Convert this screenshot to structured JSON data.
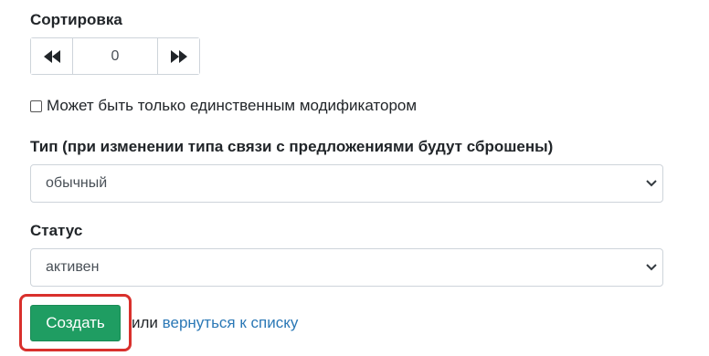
{
  "sort": {
    "label": "Сортировка",
    "value": "0"
  },
  "single_modifier": {
    "label": "Может быть только единственным модификатором",
    "checked": false
  },
  "type": {
    "label": "Тип (при изменении типа связи с предложениями будут сброшены)",
    "selected": "обычный"
  },
  "status": {
    "label": "Статус",
    "selected": "активен"
  },
  "actions": {
    "create_label": "Создать",
    "or_text": "или",
    "back_link": "вернуться к списку",
    "create_color": "#1f9d62",
    "highlight_color": "#d9302c",
    "link_color": "#2b78b6"
  },
  "icons": {
    "decrement": "fast-backward-icon",
    "increment": "fast-forward-icon",
    "select_chevron": "chevron-down-icon"
  }
}
